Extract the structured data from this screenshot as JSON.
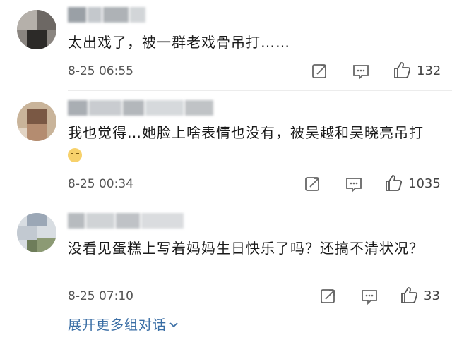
{
  "comments": [
    {
      "text": "太出戏了，被一群老戏骨吊打……",
      "time": "8-25 06:55",
      "likes": "132"
    },
    {
      "text": "我也觉得…她脸上啥表情也没有，被吴越和吴晓亮吊打",
      "time": "8-25 00:34",
      "likes": "1035"
    },
    {
      "text": "没看见蛋糕上写着妈妈生日快乐了吗？还搞不清状况？",
      "time": "8-25 07:10",
      "likes": "33"
    }
  ],
  "expand_label": "展开更多组对话",
  "icons": [
    "forward-icon",
    "comment-icon",
    "like-icon",
    "chevron-down-icon"
  ]
}
